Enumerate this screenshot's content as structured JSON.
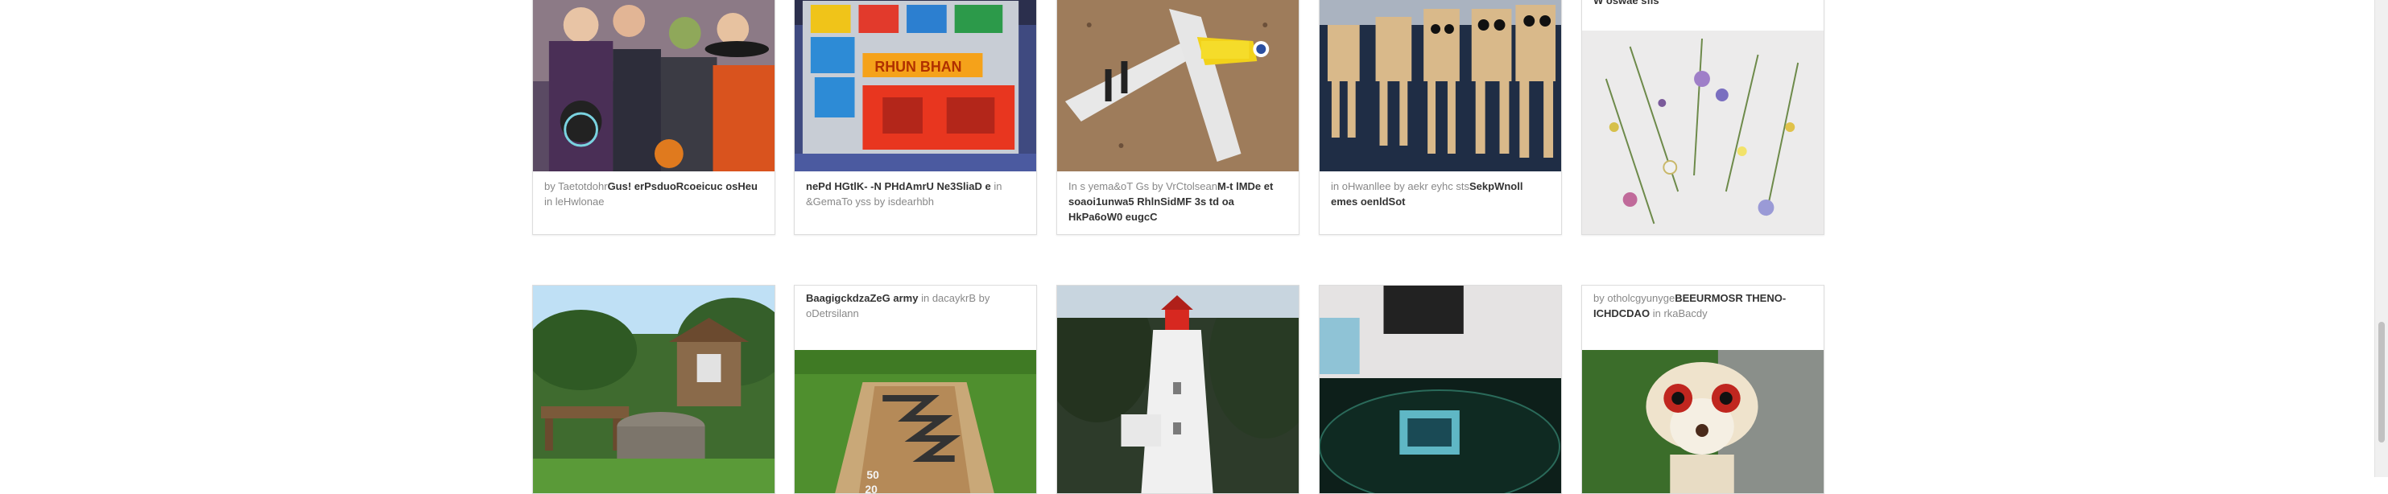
{
  "row1": [
    {
      "by": "by",
      "user": "Taetotdohr",
      "title": "Gus! erPsduoRcoeicuc osHeu",
      "in": "in",
      "category": "leHwlonae"
    },
    {
      "by": "",
      "user": "",
      "title": "nePd HGtlK- -N PHdAmrU Ne3SliaD e",
      "in": "in",
      "category": "&GemaTo yss",
      "by2": "by",
      "user2": "isdearhbh"
    },
    {
      "prefix": "In s yema&oT Gs",
      "by": "by",
      "user": "VrCtolsean",
      "title": "M-t lMDe et soaoi1unwa5 RhlnSidMF 3s td oa HkPa6oW0 eugcC"
    },
    {
      "prefix": "in oHwanllee",
      "by": "by",
      "user": "aekr eyhc sts",
      "title": "SekpWnoll emes oenldSot"
    },
    {
      "title_top": "W oswae sfls"
    }
  ],
  "row2": [
    {
      "image_only": true
    },
    {
      "title": "BaagigckdzaZeG army",
      "in": "in",
      "category": "dacaykrB",
      "by": "by",
      "user": "oDetrsilann"
    },
    {
      "image_only": true
    },
    {
      "image_only": true
    },
    {
      "by": "by",
      "user": "otholcgyunyge",
      "title": "BEEURMOSR THENO-ICHDCDAO",
      "in": "in",
      "category": "rkaBacdy"
    }
  ],
  "icons": {
    "scrollbar": "scrollbar"
  }
}
